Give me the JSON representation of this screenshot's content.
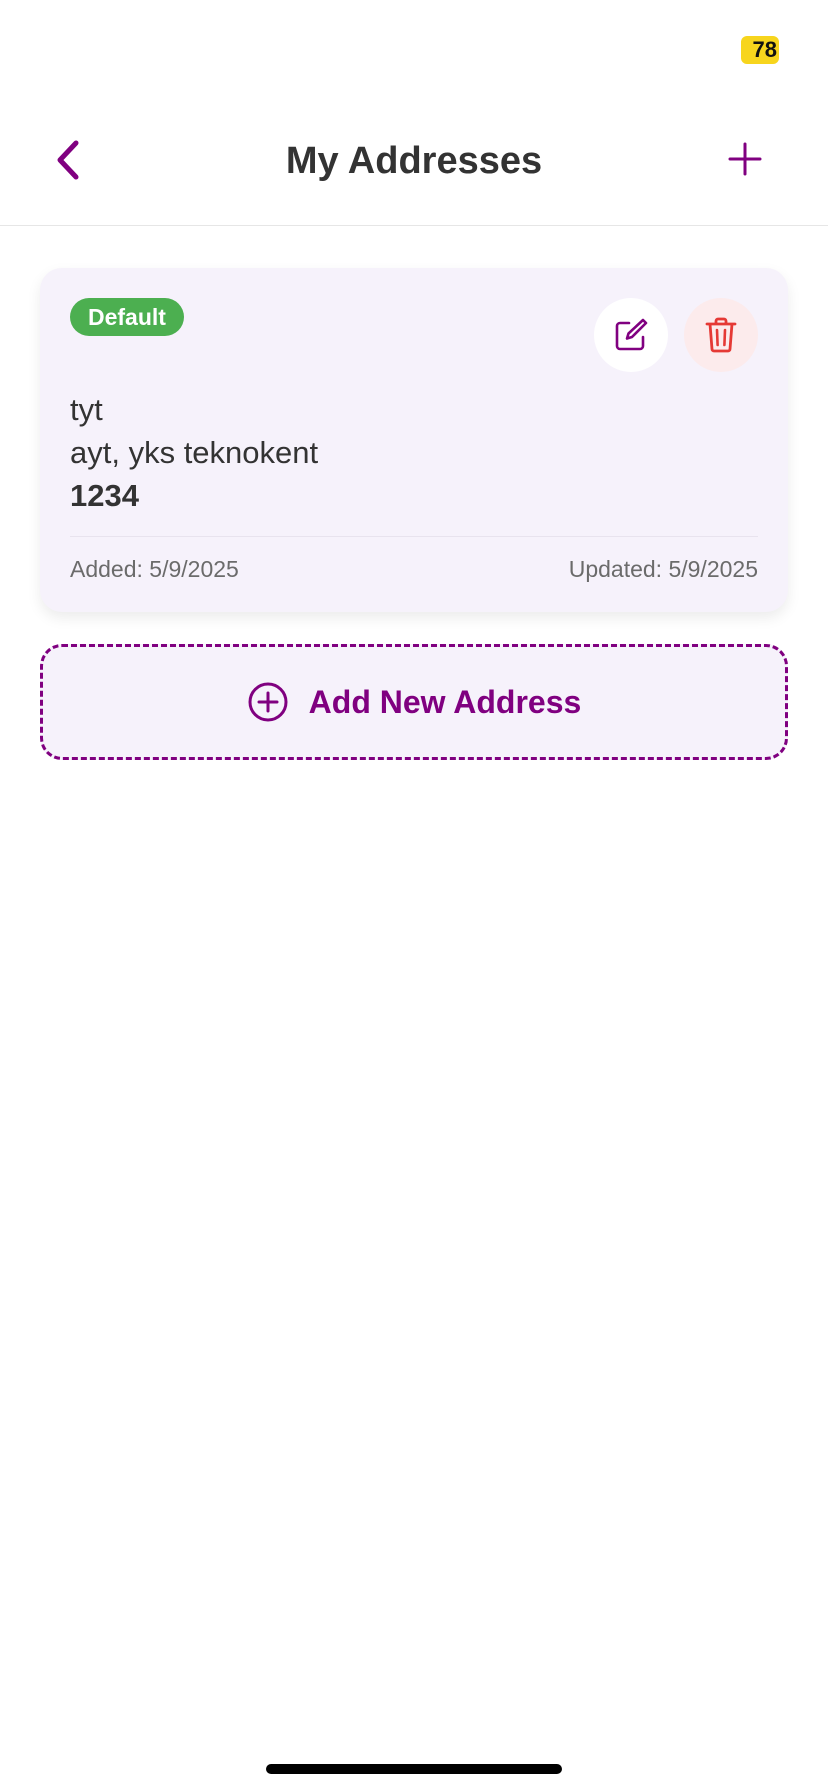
{
  "status_bar": {
    "battery_level": "78"
  },
  "header": {
    "title": "My Addresses",
    "back_icon": "chevron-left-icon",
    "add_icon": "plus-icon"
  },
  "addresses": [
    {
      "badge": "Default",
      "name": "tyt",
      "line": "ayt, yks teknokent",
      "postcode": "1234",
      "added": "Added: 5/9/2025",
      "updated": "Updated: 5/9/2025",
      "edit_icon": "edit-icon",
      "delete_icon": "trash-icon"
    }
  ],
  "add_new": {
    "label": "Add New Address",
    "icon": "plus-circle-icon"
  },
  "colors": {
    "accent": "#800080",
    "default_badge": "#4caf50",
    "delete": "#e53935",
    "card_background": "#f6f2fb",
    "battery_badge": "#f7d51d"
  }
}
